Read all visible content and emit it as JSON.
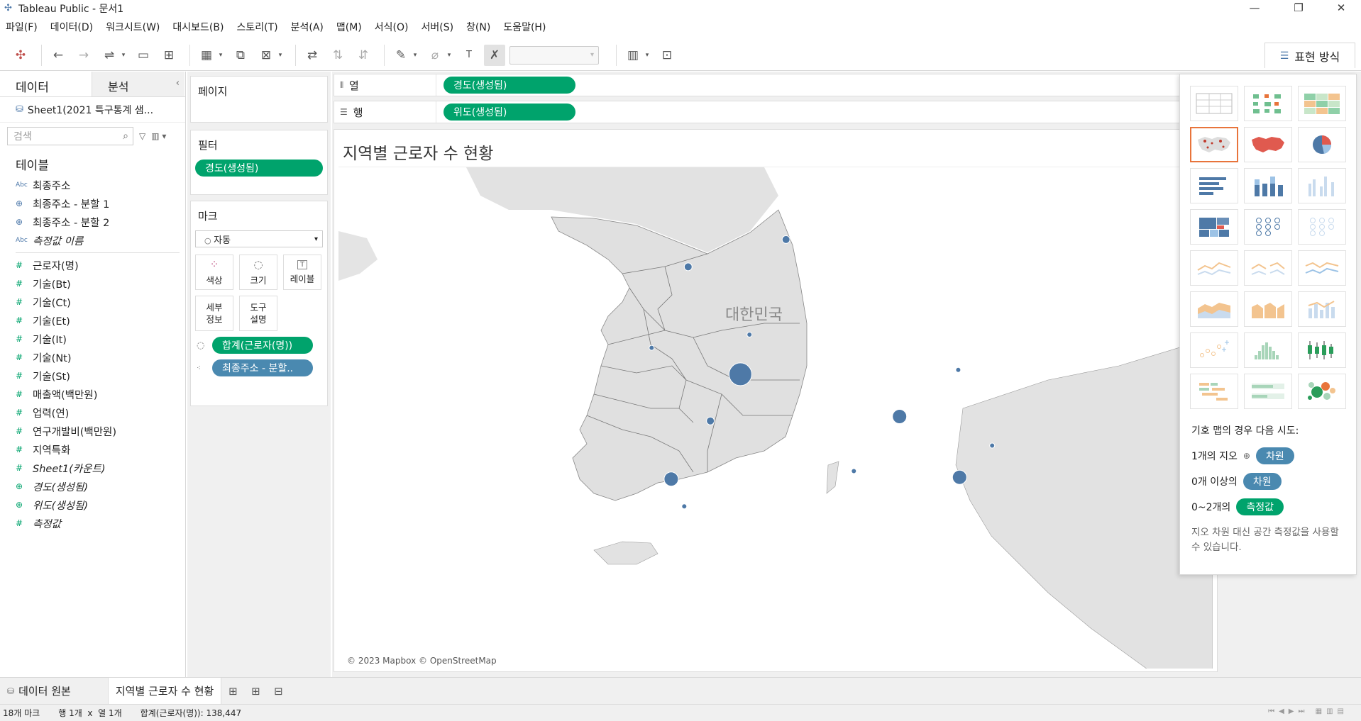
{
  "window": {
    "title": "Tableau Public - 문서1",
    "minimize": "—",
    "maximize": "❐",
    "close": "✕"
  },
  "menu": [
    "파일(F)",
    "데이터(D)",
    "워크시트(W)",
    "대시보드(B)",
    "스토리(T)",
    "분석(A)",
    "맵(M)",
    "서식(O)",
    "서버(S)",
    "창(N)",
    "도움말(H)"
  ],
  "toolbar": {
    "show_me_label": "표현 방식"
  },
  "data_pane": {
    "tab_data": "데이터",
    "tab_analysis": "분석",
    "source": "Sheet1(2021 특구통계 샘...",
    "search_placeholder": "검색",
    "tables_header": "테이블",
    "fields": [
      {
        "type": "abc",
        "label": "최종주소"
      },
      {
        "type": "geo",
        "label": "최종주소 - 분할 1"
      },
      {
        "type": "geo",
        "label": "최종주소 - 분할 2"
      },
      {
        "type": "abc",
        "label": "측정값 이름",
        "italic": true
      },
      {
        "type": "num",
        "label": "근로자(명)"
      },
      {
        "type": "num",
        "label": "기술(Bt)"
      },
      {
        "type": "num",
        "label": "기술(Ct)"
      },
      {
        "type": "num",
        "label": "기술(Et)"
      },
      {
        "type": "num",
        "label": "기술(It)"
      },
      {
        "type": "num",
        "label": "기술(Nt)"
      },
      {
        "type": "num",
        "label": "기술(St)"
      },
      {
        "type": "num",
        "label": "매출액(백만원)"
      },
      {
        "type": "num",
        "label": "업력(연)"
      },
      {
        "type": "num",
        "label": "연구개발비(백만원)"
      },
      {
        "type": "num",
        "label": "지역특화"
      },
      {
        "type": "num",
        "label": "Sheet1(카운트)",
        "italic": true
      },
      {
        "type": "geo-green",
        "label": "경도(생성됨)",
        "italic": true
      },
      {
        "type": "geo-green",
        "label": "위도(생성됨)",
        "italic": true
      },
      {
        "type": "num",
        "label": "측정값",
        "italic": true
      }
    ]
  },
  "shelves": {
    "pages_title": "페이지",
    "filters_title": "필터",
    "filter_pill": "경도(생성됨)",
    "marks_title": "마크",
    "mark_type": "자동",
    "mark_buttons": [
      {
        "icon": "color-icon",
        "glyph": "⁘",
        "label": "색상"
      },
      {
        "icon": "size-icon",
        "glyph": "◌",
        "label": "크기"
      },
      {
        "icon": "label-icon",
        "glyph": "T",
        "label": "레이블"
      },
      {
        "icon": "detail-icon",
        "glyph": "",
        "label": "세부\n정보"
      },
      {
        "icon": "tooltip-icon",
        "glyph": "",
        "label": "도구\n설명"
      }
    ],
    "mark_fields": [
      {
        "icon": "size-icon",
        "label": "합계(근로자(명))",
        "color": "green"
      },
      {
        "icon": "detail-icon",
        "label": "최종주소 - 분할..",
        "color": "blue"
      }
    ],
    "columns_label": "열",
    "columns_pill": "경도(생성됨)",
    "rows_label": "행",
    "rows_pill": "위도(생성됨)"
  },
  "sheet": {
    "title": "지역별 근로자 수 현황",
    "map_country_label": "대한민국",
    "attribution": "© 2023 Mapbox © OpenStreetMap"
  },
  "chart_data": {
    "type": "scatter",
    "title": "지역별 근로자 수 현황",
    "mark_color": "#4e79a7",
    "note": "symbol map; marks sized by 합계(근로자(명)); total 138,447",
    "points": [
      {
        "lon": 126.98,
        "lat": 37.57,
        "size": "small"
      },
      {
        "lon": 127.73,
        "lat": 37.88,
        "size": "small"
      },
      {
        "lon": 126.7,
        "lat": 36.65,
        "size": "tiny"
      },
      {
        "lon": 127.45,
        "lat": 36.8,
        "size": "tiny"
      },
      {
        "lon": 127.38,
        "lat": 36.35,
        "size": "largest"
      },
      {
        "lon": 129.05,
        "lat": 36.4,
        "size": "tiny"
      },
      {
        "lon": 127.15,
        "lat": 35.82,
        "size": "small"
      },
      {
        "lon": 128.6,
        "lat": 35.87,
        "size": "medium"
      },
      {
        "lon": 129.31,
        "lat": 35.54,
        "size": "tiny"
      },
      {
        "lon": 128.25,
        "lat": 35.25,
        "size": "tiny"
      },
      {
        "lon": 126.85,
        "lat": 35.16,
        "size": "medium"
      },
      {
        "lon": 129.06,
        "lat": 35.18,
        "size": "medium"
      },
      {
        "lon": 126.95,
        "lat": 34.85,
        "size": "tiny"
      }
    ]
  },
  "show_me": {
    "hint_title": "기호 맵의 경우 다음 시도:",
    "rows": [
      {
        "prefix": "1개의 지오",
        "pill": "차원",
        "color": "blue",
        "has_geo": true
      },
      {
        "prefix": "0개 이상의",
        "pill": "차원",
        "color": "blue",
        "has_geo": false
      },
      {
        "prefix": "0~2개의",
        "pill": "측정값",
        "color": "green",
        "has_geo": false
      }
    ],
    "note": "지오 차원 대신 공간 측정값을 사용할 수 있습니다."
  },
  "bottom_tabs": {
    "data_source": "데이터 원본",
    "sheet_tab": "지역별 근로자 수 현황"
  },
  "status": {
    "marks": "18개 마크",
    "rows_cols": "행 1개  x  열 1개",
    "sum": "합계(근로자(명)): 138,447"
  }
}
